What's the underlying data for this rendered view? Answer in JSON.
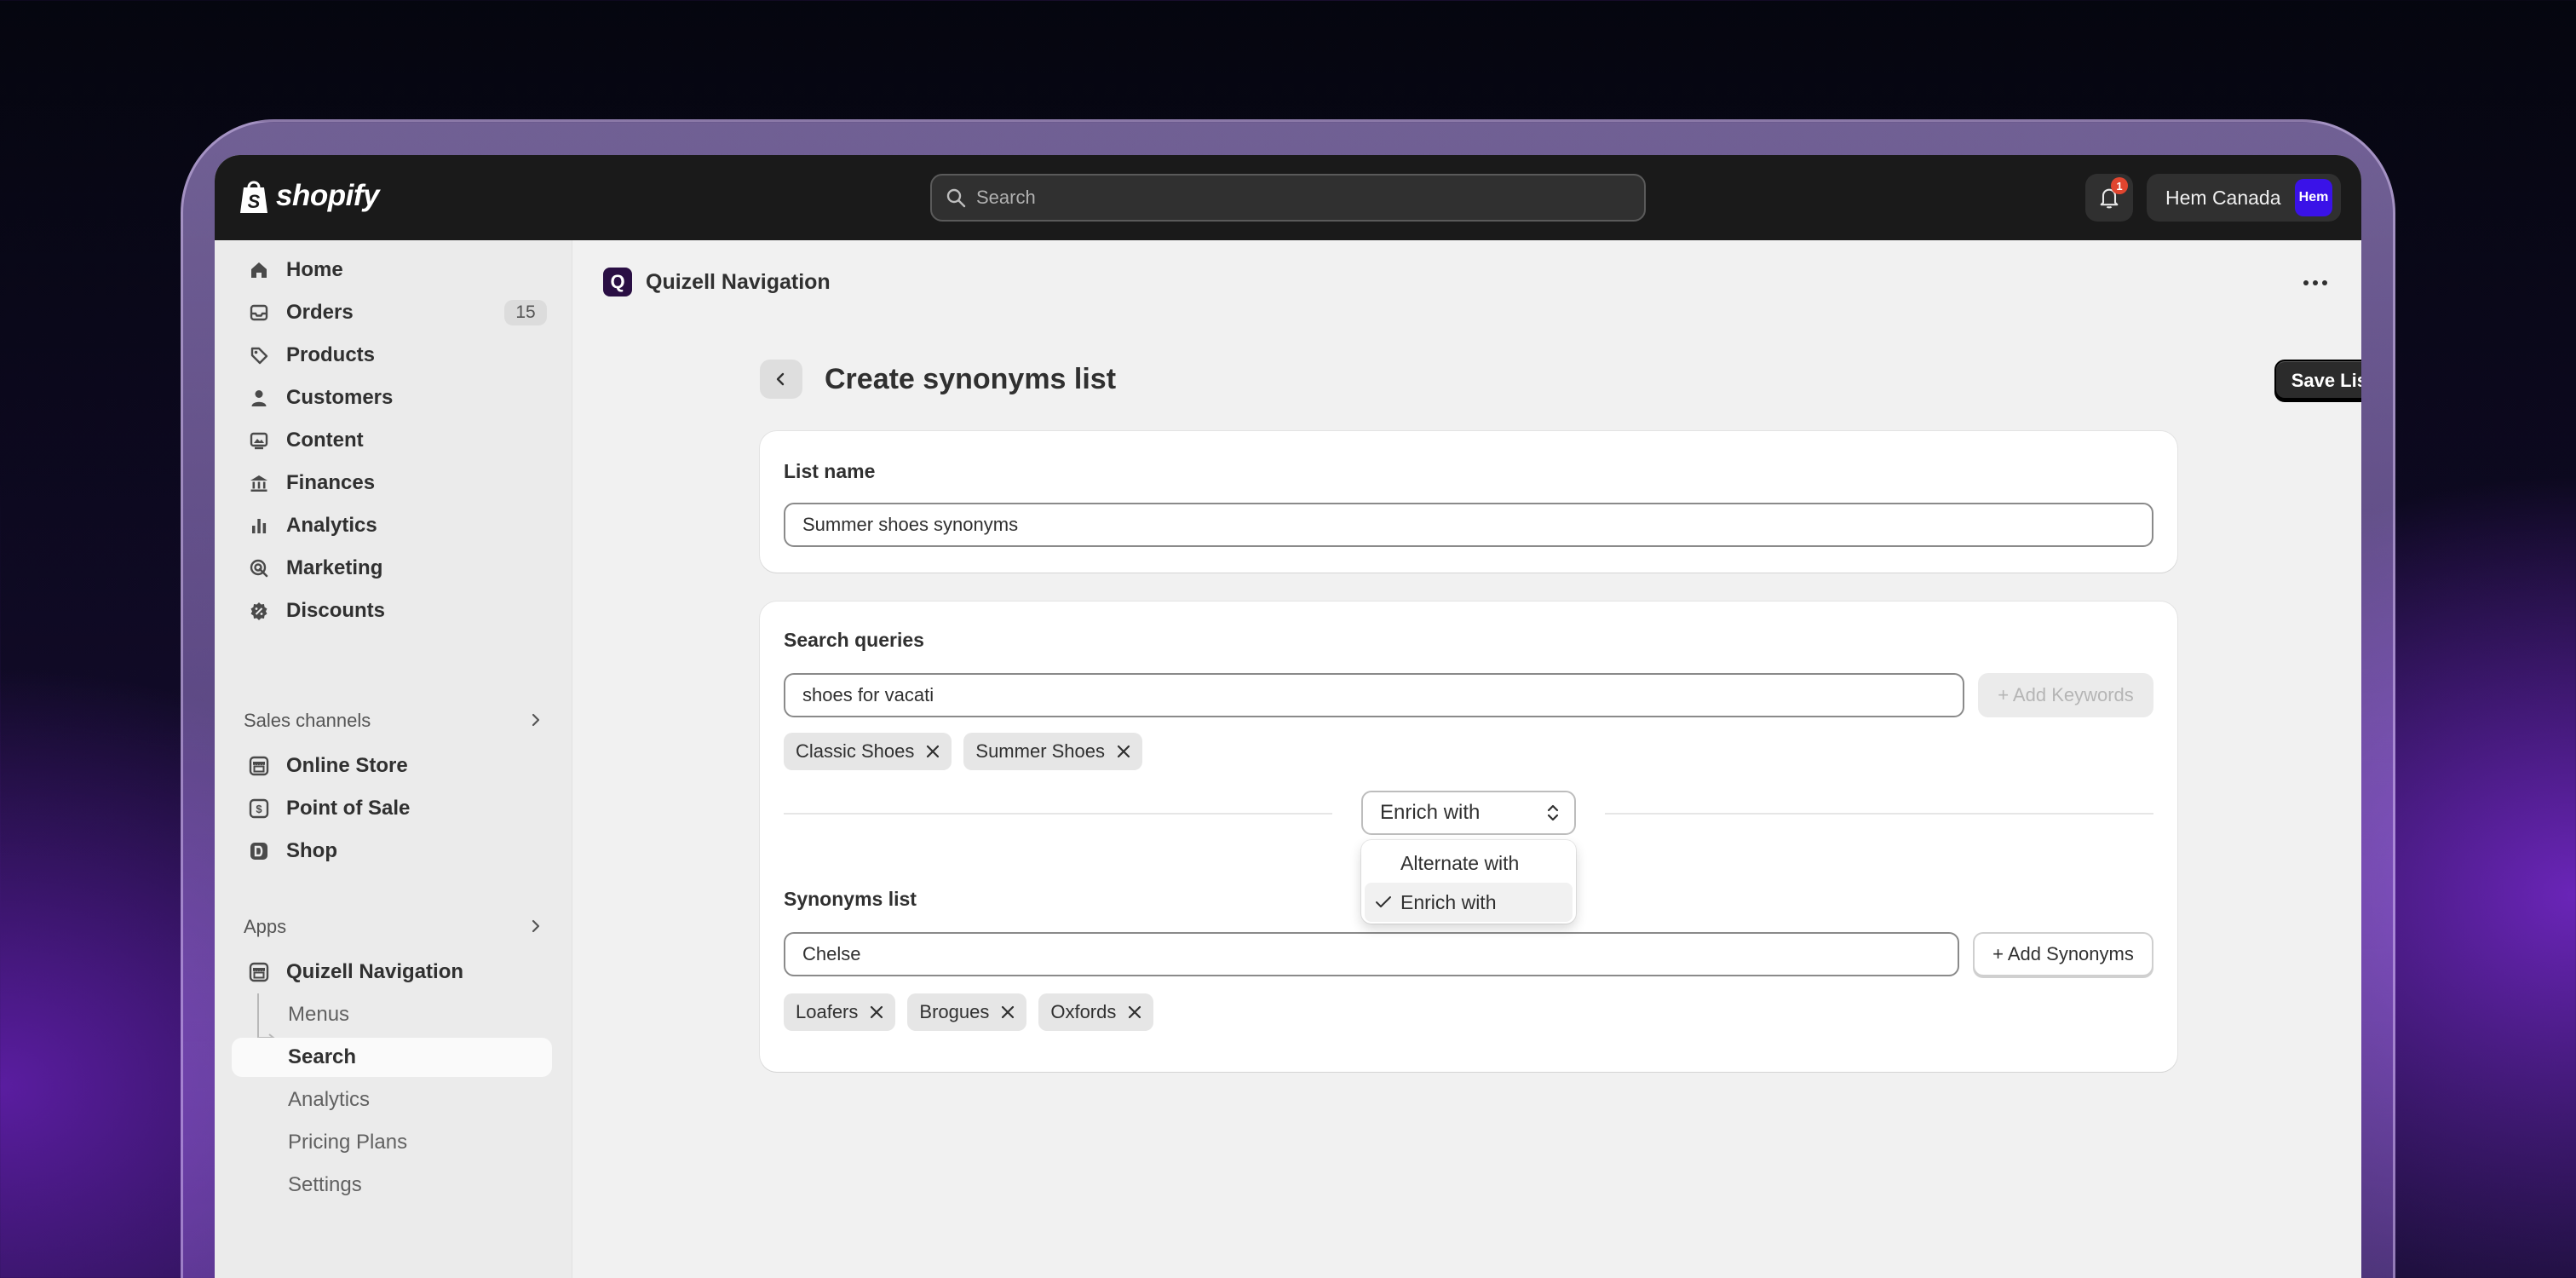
{
  "topbar": {
    "logo_text": "shopify",
    "search_placeholder": "Search",
    "notification_count": "1",
    "store_name": "Hem Canada",
    "avatar_text": "Hem"
  },
  "sidebar": {
    "main_items": [
      {
        "label": "Home",
        "icon": "home-icon"
      },
      {
        "label": "Orders",
        "icon": "inbox-icon",
        "count": "15"
      },
      {
        "label": "Products",
        "icon": "tag-icon"
      },
      {
        "label": "Customers",
        "icon": "person-icon"
      },
      {
        "label": "Content",
        "icon": "image-icon"
      },
      {
        "label": "Finances",
        "icon": "bank-icon"
      },
      {
        "label": "Analytics",
        "icon": "bar-chart-icon"
      },
      {
        "label": "Marketing",
        "icon": "target-icon"
      },
      {
        "label": "Discounts",
        "icon": "discount-icon"
      }
    ],
    "sales_channels_label": "Sales channels",
    "sales_channels": [
      {
        "label": "Online Store",
        "icon": "store-icon"
      },
      {
        "label": "Point of Sale",
        "icon": "pos-icon"
      },
      {
        "label": "Shop",
        "icon": "shop-icon"
      }
    ],
    "apps_label": "Apps",
    "app_name": "Quizell Navigation",
    "app_subitems": [
      "Menus",
      "Search",
      "Analytics",
      "Pricing Plans",
      "Settings"
    ],
    "active_subitem": "Search"
  },
  "main": {
    "app_logo": "Q",
    "app_title": "Quizell Navigation",
    "page_title": "Create synonyms list",
    "save_label": "Save List",
    "list_name": {
      "label": "List name",
      "value": "Summer shoes synonyms"
    },
    "queries": {
      "label": "Search queries",
      "input_value": "shoes for vacati",
      "add_label": "+ Add Keywords",
      "tags": [
        "Classic Shoes",
        "Summer Shoes"
      ]
    },
    "mode": {
      "selected": "Enrich with",
      "options": [
        "Alternate with",
        "Enrich with"
      ]
    },
    "synonyms": {
      "label": "Synonyms list",
      "input_value": "Chelse",
      "add_label": "+ Add Synonyms",
      "tags": [
        "Loafers",
        "Brogues",
        "Oxfords"
      ]
    }
  },
  "colors": {
    "topbar_bg": "#1a1a1a",
    "avatar_bg": "#3a12e8",
    "badge": "#e0452f",
    "primary_button": "#2b2b2b"
  }
}
